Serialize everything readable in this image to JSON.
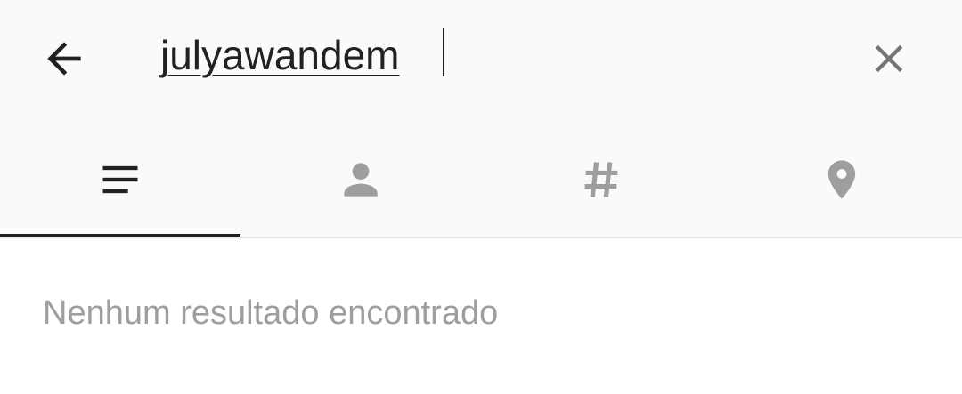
{
  "search": {
    "query": "julyawandem"
  },
  "icons": {
    "back": "arrow-back-icon",
    "clear": "close-icon",
    "tab_top": "notes-icon",
    "tab_people": "person-icon",
    "tab_tags": "hashtag-icon",
    "tab_places": "location-pin-icon"
  },
  "tabs": [
    {
      "name": "top",
      "icon": "notes-icon",
      "selected": true
    },
    {
      "name": "people",
      "icon": "person-icon",
      "selected": false
    },
    {
      "name": "tags",
      "icon": "hashtag-icon",
      "selected": false
    },
    {
      "name": "places",
      "icon": "location-pin-icon",
      "selected": false
    }
  ],
  "results": {
    "empty_message": "Nenhum resultado encontrado"
  },
  "colors": {
    "toolbar_bg": "#fafafa",
    "active_icon": "#212121",
    "inactive_icon": "#9e9e9e",
    "message_text": "#9e9e9e"
  }
}
